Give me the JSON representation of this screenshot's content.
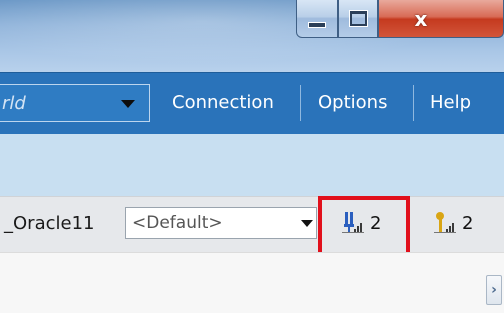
{
  "window": {
    "minimize_glyph": "minimize-icon",
    "maximize_glyph": "maximize-icon",
    "close_label": "x"
  },
  "menubar": {
    "database_select_value": "rld",
    "items": [
      {
        "label": "Connection"
      },
      {
        "label": "Options"
      },
      {
        "label": "Help"
      }
    ]
  },
  "toolbar": {
    "connection_name": "_Oracle11",
    "profile_select_value": "<Default>",
    "status_items": [
      {
        "icon": "signal-blue-icon",
        "count": "2"
      },
      {
        "icon": "signal-gold-icon",
        "count": "2"
      }
    ]
  },
  "colors": {
    "menubar_bg": "#2a73ba",
    "band_bg": "#c8dff1",
    "highlight_border": "#e1101c",
    "close_button": "#c53a1f"
  },
  "scrollbar": {
    "arrow": "›"
  }
}
